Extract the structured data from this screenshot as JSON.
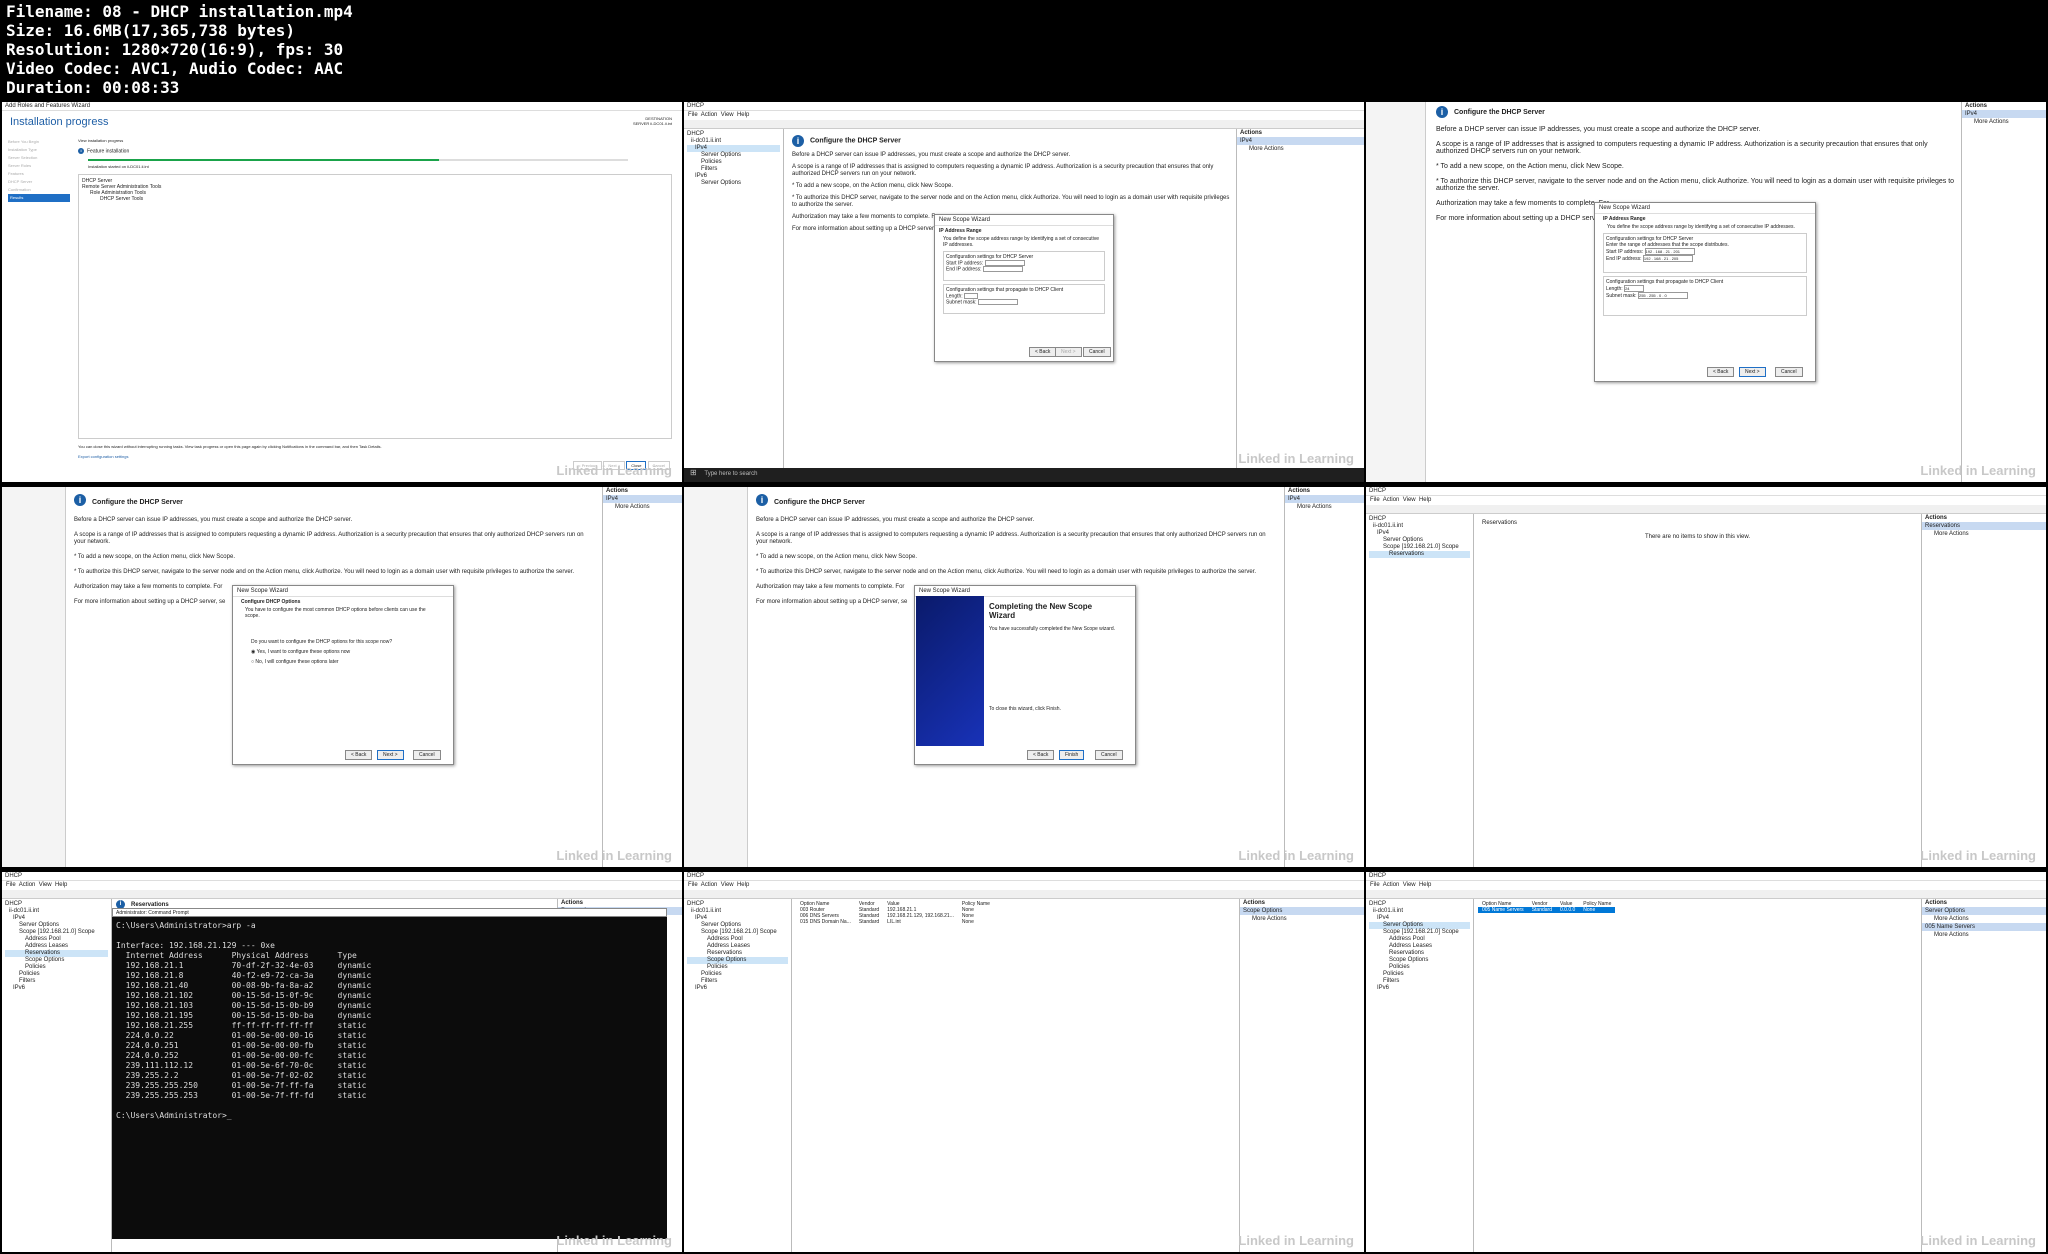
{
  "header": {
    "filename": "Filename: 08 - DHCP installation.mp4",
    "size": "Size: 16.6MB(17,365,738 bytes)",
    "resolution": "Resolution: 1280×720(16:9), fps: 30",
    "codec": "Video Codec: AVC1, Audio Codec: AAC",
    "duration": "Duration: 00:08:33"
  },
  "watermark": "Linked in Learning",
  "common": {
    "dhcp_title": "DHCP",
    "menu": [
      "File",
      "Action",
      "View",
      "Help"
    ],
    "actions_header": "Actions",
    "more_actions": "More Actions",
    "ipv4": "IPv4",
    "ipv6": "IPv6",
    "server_options": "Server Options",
    "policies": "Policies",
    "filters": "Filters",
    "scope": "Scope [192.168.21.0] Scope",
    "address_pool": "Address Pool",
    "address_leases": "Address Leases",
    "reservations": "Reservations",
    "scope_options": "Scope Options",
    "server_node": "ii-dc01.ii.int"
  },
  "configure": {
    "title": "Configure the DHCP Server",
    "p1": "Before a DHCP server can issue IP addresses, you must create a scope and authorize the DHCP server.",
    "p2": "A scope is a range of IP addresses that is assigned to computers requesting a dynamic IP address. Authorization is a security precaution that ensures that only authorized DHCP servers run on your network.",
    "p3": "* To add a new scope, on the Action menu, click New Scope.",
    "p4": "* To authorize this DHCP server, navigate to the server node and on the Action menu, click Authorize. You will need to login as a domain user with requisite privileges to authorize the server.",
    "p5": "Authorization may take a few moments to complete. For",
    "p6": "For more information about setting up a DHCP server, se"
  },
  "cell1": {
    "window_title": "Add Roles and Features Wizard",
    "heading": "Installation progress",
    "dest": "DESTINATION SERVER ii-DC01.ii.int",
    "nav": [
      "Before You Begin",
      "Installation Type",
      "Server Selection",
      "Server Roles",
      "Features",
      "DHCP Server",
      "Confirmation",
      "Results"
    ],
    "view_progress": "View installation progress",
    "feature_install": "Feature installation",
    "install_started": "Installation started on ii-DC01.ii.int",
    "items": [
      "DHCP Server",
      "Remote Server Administration Tools",
      "Role Administration Tools",
      "DHCP Server Tools"
    ],
    "note": "You can close this wizard without interrupting running tasks. View task progress or open this page again by clicking Notifications in the command bar, and then Task Details.",
    "export": "Export configuration settings",
    "buttons": [
      "< Previous",
      "Next >",
      "Close",
      "Cancel"
    ]
  },
  "wizard": {
    "title": "New Scope Wizard",
    "ip_range": "IP Address Range",
    "ip_range_desc": "You define the scope address range by identifying a set of consecutive IP addresses.",
    "cfg_server": "Configuration settings for DHCP Server",
    "enter_range": "Enter the range of addresses that the scope distributes.",
    "start_ip": "Start IP address:",
    "end_ip": "End IP address:",
    "cfg_client": "Configuration settings that propagate to DHCP Client",
    "length": "Length:",
    "subnet": "Subnet mask:",
    "start_val": "192 . 168 . 21 . 201",
    "end_val": "192 . 168 . 21 . 205",
    "length_val": "24",
    "subnet_val": "255 . 255 . 0 . 0",
    "back": "< Back",
    "next": "Next >",
    "cancel": "Cancel",
    "finish": "Finish",
    "cfg_opts": "Configure DHCP Options",
    "cfg_opts_desc": "You have to configure the most common DHCP options before clients can use the scope.",
    "opt_q": "Do you want to configure the DHCP options for this scope now?",
    "opt_yes": "Yes, I want to configure these options now",
    "opt_no": "No, I will configure these options later",
    "completing": "Completing the New Scope Wizard",
    "completed": "You have successfully completed the New Scope wizard.",
    "close_click": "To close this wizard, click Finish."
  },
  "reservations_panel": {
    "header": "Reservations",
    "empty": "There are no items to show in this view."
  },
  "cmd": {
    "title": "Administrator: Command Prompt",
    "lines": [
      "C:\\Users\\Administrator>arp -a",
      "",
      "Interface: 192.168.21.129 --- 0xe",
      "  Internet Address      Physical Address      Type",
      "  192.168.21.1          70-df-2f-32-4e-03     dynamic",
      "  192.168.21.8          40-f2-e9-72-ca-3a     dynamic",
      "  192.168.21.40         00-08-9b-fa-8a-a2     dynamic",
      "  192.168.21.102        00-15-5d-15-0f-9c     dynamic",
      "  192.168.21.103        00-15-5d-15-0b-b9     dynamic",
      "  192.168.21.195        00-15-5d-15-0b-ba     dynamic",
      "  192.168.21.255        ff-ff-ff-ff-ff-ff     static",
      "  224.0.0.22            01-00-5e-00-00-16     static",
      "  224.0.0.251           01-00-5e-00-00-fb     static",
      "  224.0.0.252           01-00-5e-00-00-fc     static",
      "  239.111.112.12        01-00-5e-6f-70-0c     static",
      "  239.255.2.2           01-00-5e-7f-02-02     static",
      "  239.255.255.250       01-00-5e-7f-ff-fa     static",
      "  239.255.255.253       01-00-5e-7f-ff-fd     static",
      "",
      "C:\\Users\\Administrator>_"
    ]
  },
  "options_table": {
    "headers": [
      "Option Name",
      "Vendor",
      "Value",
      "Policy Name"
    ],
    "rows": [
      [
        "003 Router",
        "Standard",
        "192.168.21.1",
        "None"
      ],
      [
        "006 DNS Servers",
        "Standard",
        "192.168.21.129, 192.168.21...",
        "None"
      ],
      [
        "015 DNS Domain Na...",
        "Standard",
        "LIL.int",
        "None"
      ]
    ],
    "rows2": [
      [
        "005 Name Servers",
        "Standard",
        "0.0.0.0",
        "None"
      ]
    ],
    "name_servers_action": "005 Name Servers"
  },
  "taskbar": {
    "search": "Type here to search"
  }
}
